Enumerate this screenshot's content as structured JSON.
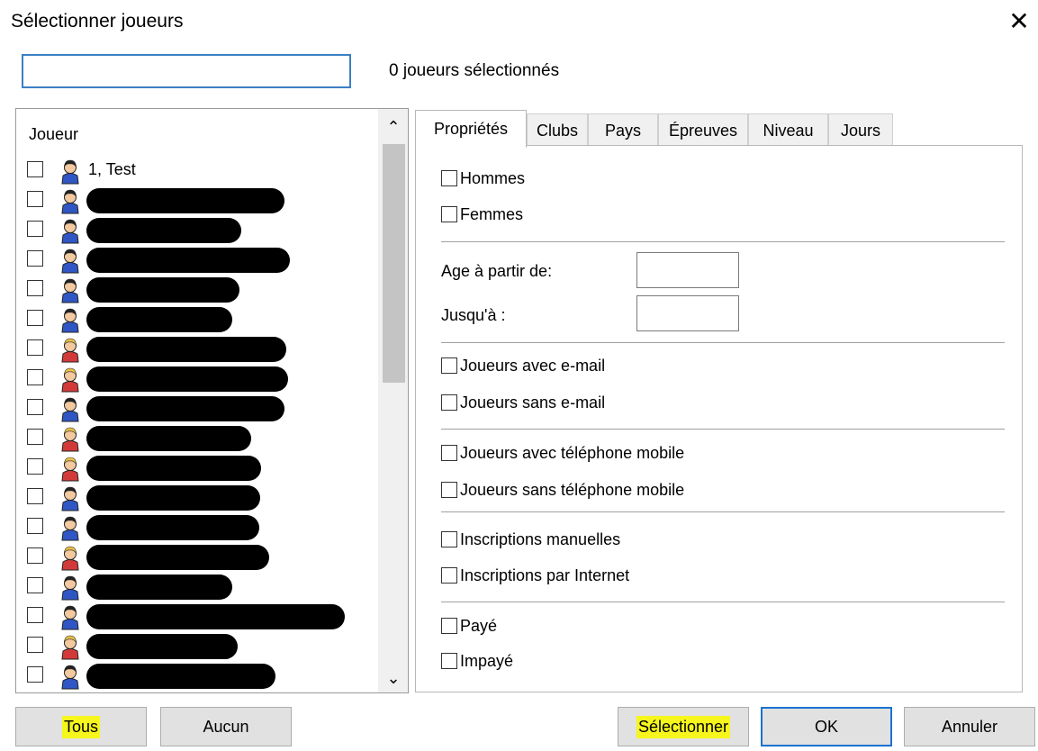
{
  "window": {
    "title": "Sélectionner joueurs",
    "close_symbol": "✕"
  },
  "search": {
    "value": "",
    "placeholder": ""
  },
  "selection_status": "0 joueurs sélectionnés",
  "player_list": {
    "header": "Joueur",
    "rows": [
      {
        "label": "1, Test",
        "icon": "male-player-icon",
        "redacted": false
      },
      {
        "label": "",
        "icon": "male-player-icon",
        "redacted": true
      },
      {
        "label": "",
        "icon": "male-player-icon",
        "redacted": true
      },
      {
        "label": "",
        "icon": "male-player-icon",
        "redacted": true
      },
      {
        "label": "",
        "icon": "male-player-icon",
        "redacted": true
      },
      {
        "label": "",
        "icon": "male-player-icon",
        "redacted": true
      },
      {
        "label": "",
        "icon": "female-player-icon",
        "redacted": true
      },
      {
        "label": "",
        "icon": "female-player-icon",
        "redacted": true
      },
      {
        "label": "",
        "icon": "male-player-icon",
        "redacted": true
      },
      {
        "label": "",
        "icon": "female-player-icon",
        "redacted": true
      },
      {
        "label": "",
        "icon": "female-player-icon",
        "redacted": true
      },
      {
        "label": "",
        "icon": "male-player-icon",
        "redacted": true
      },
      {
        "label": "",
        "icon": "male-player-icon",
        "redacted": true
      },
      {
        "label": "",
        "icon": "female-player-icon",
        "redacted": true
      },
      {
        "label": "",
        "icon": "male-player-icon",
        "redacted": true
      },
      {
        "label": "",
        "icon": "male-player-icon",
        "redacted": true
      },
      {
        "label": "",
        "icon": "female-player-icon",
        "redacted": true
      },
      {
        "label": "",
        "icon": "male-player-icon",
        "redacted": true
      }
    ],
    "scroll_up": "⌃",
    "scroll_down": "⌄"
  },
  "tabs": [
    {
      "label": "Propriétés",
      "active": true
    },
    {
      "label": "Clubs",
      "active": false
    },
    {
      "label": "Pays",
      "active": false
    },
    {
      "label": "Épreuves",
      "active": false
    },
    {
      "label": "Niveau",
      "active": false
    },
    {
      "label": "Jours",
      "active": false
    }
  ],
  "properties": {
    "men": "Hommes",
    "women": "Femmes",
    "age_from_label": "Age à partir de:",
    "age_from_value": "",
    "age_to_label": "Jusqu'à :",
    "age_to_value": "",
    "with_email": "Joueurs avec e-mail",
    "without_email": "Joueurs sans e-mail",
    "with_mobile": "Joueurs avec téléphone mobile",
    "without_mobile": "Joueurs sans téléphone mobile",
    "manual_entries": "Inscriptions manuelles",
    "internet_entries": "Inscriptions par Internet",
    "paid": "Payé",
    "unpaid": "Impayé"
  },
  "buttons": {
    "all": "Tous",
    "none": "Aucun",
    "select": "Sélectionner",
    "ok": "OK",
    "cancel": "Annuler"
  },
  "colors": {
    "highlight": "#f6f61d",
    "default_button_border": "#1b72d0",
    "male_icon": "#2f56c4",
    "female_icon": "#d23a3a"
  }
}
